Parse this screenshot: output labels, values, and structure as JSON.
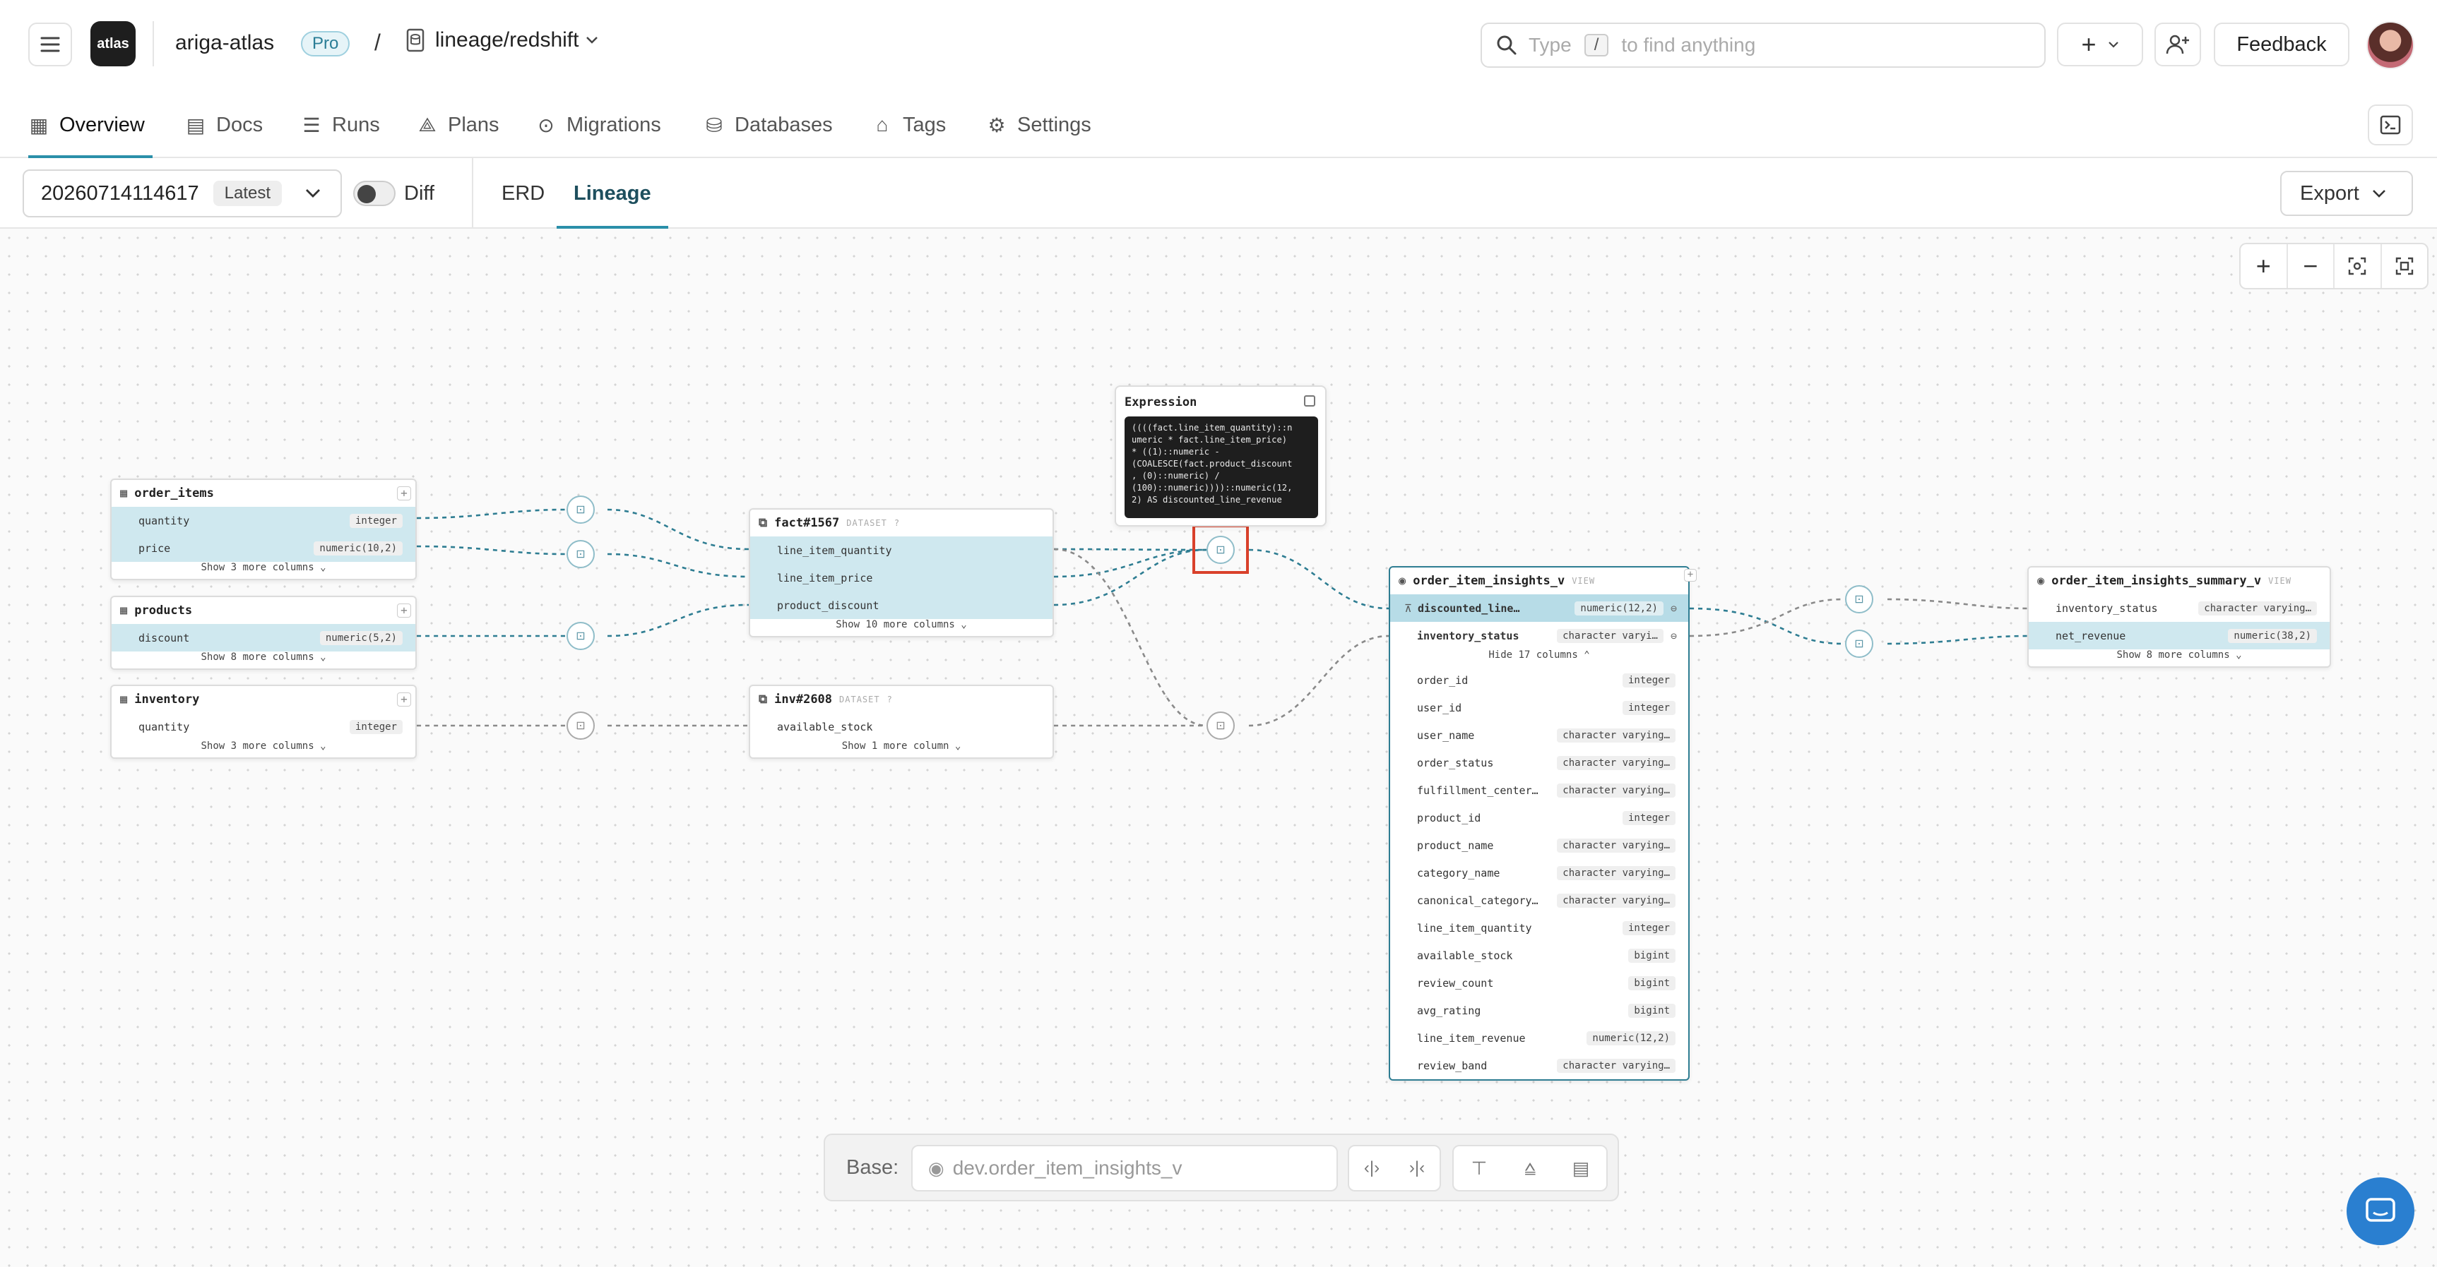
{
  "header": {
    "org": "ariga-atlas",
    "plan_badge": "Pro",
    "separator": "/",
    "repo": "lineage/redshift",
    "search": {
      "placeholder_prefix": "Type",
      "shortcut": "/",
      "placeholder_suffix": "to find anything"
    },
    "feedback_label": "Feedback",
    "logo_text": "atlas"
  },
  "nav": {
    "tabs": [
      {
        "label": "Overview",
        "icon": "board-icon"
      },
      {
        "label": "Docs",
        "icon": "book-icon"
      },
      {
        "label": "Runs",
        "icon": "list-icon"
      },
      {
        "label": "Plans",
        "icon": "compass-icon"
      },
      {
        "label": "Migrations",
        "icon": "play-circle-icon"
      },
      {
        "label": "Databases",
        "icon": "database-icon"
      },
      {
        "label": "Tags",
        "icon": "tag-icon"
      },
      {
        "label": "Settings",
        "icon": "gear-icon"
      }
    ]
  },
  "toolbar": {
    "version": "20260714114617",
    "version_badge": "Latest",
    "diff_label": "Diff",
    "view_tabs": [
      "ERD",
      "Lineage"
    ],
    "export_label": "Export"
  },
  "canvas": {
    "expression": {
      "title": "Expression",
      "code": "((((fact.line_item_quantity)::n\numeric * fact.line_item_price)\n* ((1)::numeric -\n(COALESCE(fact.product_discount\n, (0)::numeric) /\n(100)::numeric))))::numeric(12,\n2) AS discounted_line_revenue"
    },
    "tables": {
      "order_items": {
        "name": "order_items",
        "rows": [
          {
            "name": "quantity",
            "type": "integer"
          },
          {
            "name": "price",
            "type": "numeric(10,2)"
          }
        ],
        "more": "Show 3 more columns"
      },
      "products": {
        "name": "products",
        "rows": [
          {
            "name": "discount",
            "type": "numeric(5,2)"
          }
        ],
        "more": "Show 8 more columns"
      },
      "inventory": {
        "name": "inventory",
        "rows": [
          {
            "name": "quantity",
            "type": "integer"
          }
        ],
        "more": "Show 3 more columns"
      },
      "fact": {
        "name": "fact#1567",
        "tag": "DATASET",
        "rows": [
          {
            "name": "line_item_quantity"
          },
          {
            "name": "line_item_price"
          },
          {
            "name": "product_discount"
          }
        ],
        "more": "Show 10 more columns"
      },
      "inv": {
        "name": "inv#2608",
        "tag": "DATASET",
        "rows": [
          {
            "name": "available_stock"
          }
        ],
        "more": "Show 1 more column"
      },
      "insights": {
        "name": "order_item_insights_v",
        "tag": "VIEW",
        "pinned": [
          {
            "name": "discounted_line…",
            "type": "numeric(12,2)"
          },
          {
            "name": "inventory_status",
            "type": "character varyi…"
          }
        ],
        "hide": "Hide 17 columns",
        "rows": [
          {
            "name": "order_id",
            "type": "integer"
          },
          {
            "name": "user_id",
            "type": "integer"
          },
          {
            "name": "user_name",
            "type": "character varying…"
          },
          {
            "name": "order_status",
            "type": "character varying…"
          },
          {
            "name": "fulfillment_center…",
            "type": "character varying…"
          },
          {
            "name": "product_id",
            "type": "integer"
          },
          {
            "name": "product_name",
            "type": "character varying…"
          },
          {
            "name": "category_name",
            "type": "character varying…"
          },
          {
            "name": "canonical_category…",
            "type": "character varying…"
          },
          {
            "name": "line_item_quantity",
            "type": "integer"
          },
          {
            "name": "available_stock",
            "type": "bigint"
          },
          {
            "name": "review_count",
            "type": "bigint"
          },
          {
            "name": "avg_rating",
            "type": "bigint"
          },
          {
            "name": "line_item_revenue",
            "type": "numeric(12,2)"
          },
          {
            "name": "review_band",
            "type": "character varying…"
          }
        ]
      },
      "summary": {
        "name": "order_item_insights_summary_v",
        "tag": "VIEW",
        "rows": [
          {
            "name": "inventory_status",
            "type": "character varying…"
          },
          {
            "name": "net_revenue",
            "type": "numeric(38,2)"
          }
        ],
        "more": "Show 8 more columns"
      }
    },
    "base_bar": {
      "label": "Base:",
      "value": "dev.order_item_insights_v"
    }
  }
}
